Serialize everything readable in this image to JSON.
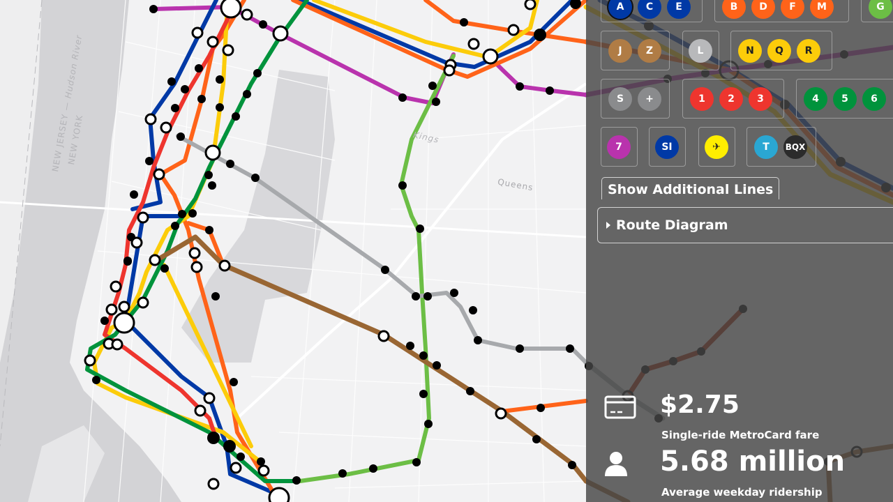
{
  "map": {
    "labels": {
      "nj": "NEW JERSEY",
      "ny": "NEW YORK",
      "hudson": "Hudson River",
      "kings": "Kings",
      "queens": "Queens"
    },
    "colors": {
      "blue": "#0039a6",
      "orange": "#ff6319",
      "yellow": "#fccc0a",
      "red": "#ee352e",
      "green": "#00933c",
      "lime": "#6cbe45",
      "purple": "#b933ad",
      "gray": "#a7a9ac",
      "brown": "#996633"
    }
  },
  "panel": {
    "line_groups": [
      {
        "lines": [
          {
            "label": "A",
            "color": "#0039a6"
          },
          {
            "label": "C",
            "color": "#0039a6"
          },
          {
            "label": "E",
            "color": "#0039a6"
          }
        ]
      },
      {
        "lines": [
          {
            "label": "B",
            "color": "#ff6319"
          },
          {
            "label": "D",
            "color": "#ff6319"
          },
          {
            "label": "F",
            "color": "#ff6319"
          },
          {
            "label": "M",
            "color": "#ff6319"
          }
        ]
      },
      {
        "lines": [
          {
            "label": "G",
            "color": "#6cbe45"
          }
        ]
      },
      {
        "lines": [
          {
            "label": "J",
            "color": "#996633"
          },
          {
            "label": "Z",
            "color": "#996633"
          }
        ]
      },
      {
        "lines": [
          {
            "label": "L",
            "color": "#a7a9ac"
          }
        ]
      },
      {
        "lines": [
          {
            "label": "N",
            "color": "#fccc0a"
          },
          {
            "label": "Q",
            "color": "#fccc0a"
          },
          {
            "label": "R",
            "color": "#fccc0a"
          }
        ]
      },
      {
        "lines": [
          {
            "label": "S",
            "color": "#808183"
          },
          {
            "label": "+",
            "color": "#808183"
          }
        ]
      },
      {
        "lines": [
          {
            "label": "1",
            "color": "#ee352e"
          },
          {
            "label": "2",
            "color": "#ee352e"
          },
          {
            "label": "3",
            "color": "#ee352e"
          }
        ]
      },
      {
        "lines": [
          {
            "label": "4",
            "color": "#00933c"
          },
          {
            "label": "5",
            "color": "#00933c"
          },
          {
            "label": "6",
            "color": "#00933c"
          }
        ]
      },
      {
        "lines": [
          {
            "label": "7",
            "color": "#b933ad"
          }
        ]
      },
      {
        "lines": [
          {
            "label": "SI",
            "color": "#0039a6"
          }
        ]
      },
      {
        "lines": [
          {
            "label": "airplane-icon",
            "icon": "✈",
            "color": "#ffee00"
          }
        ]
      },
      {
        "lines": [
          {
            "label": "T",
            "color": "#2aa7d3"
          },
          {
            "label": "BQX",
            "color": "#2b2b2b"
          }
        ]
      }
    ],
    "show_additional_lines": "Show Additional Lines",
    "route_diagram": "Route Diagram",
    "stats": [
      {
        "icon": "metrocard-icon",
        "value": "$2.75",
        "label": "Single-ride MetroCard fare"
      },
      {
        "icon": "person-icon",
        "value": "5.68 million",
        "label": "Average weekday ridership"
      }
    ]
  }
}
